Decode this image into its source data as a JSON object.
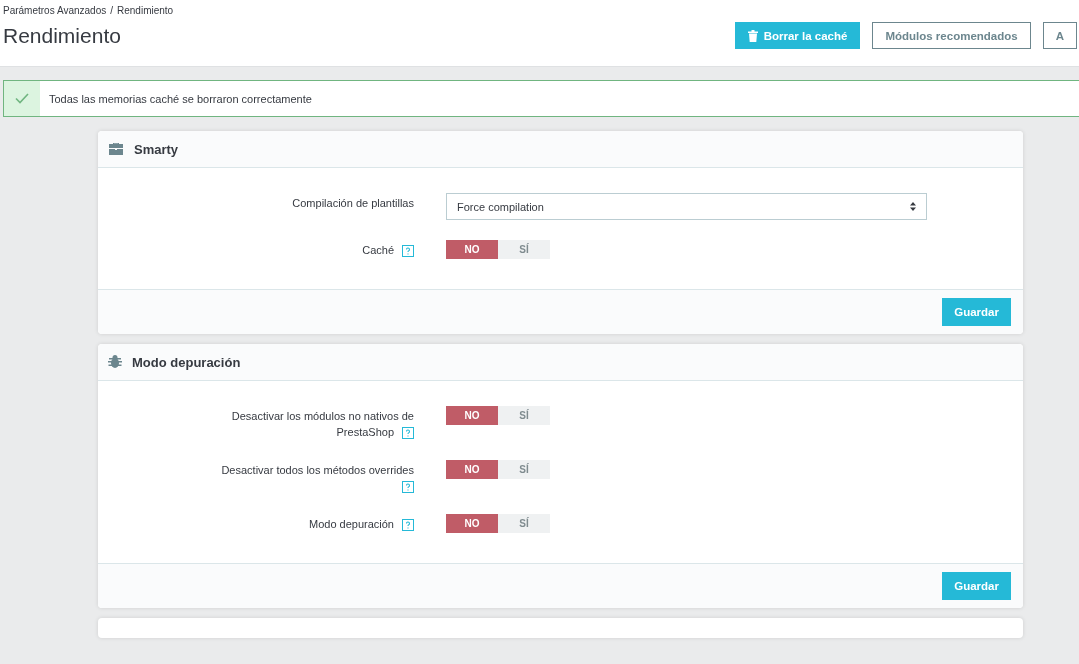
{
  "breadcrumb": [
    "Parámetros Avanzados",
    "Rendimiento"
  ],
  "breadcrumb_separator": "/",
  "title": "Rendimiento",
  "toolbar": [
    {
      "label": "Borrar la caché",
      "kind": "primary"
    },
    {
      "label": "Módulos recomendados",
      "kind": "outline"
    },
    {
      "label": "A",
      "kind": "outline"
    }
  ],
  "alert": {
    "message": "Todas las memorias caché se borraron correctamente"
  },
  "panels": [
    {
      "title": "Smarty",
      "fields": [
        {
          "kind": "select",
          "label": "Compilación de plantillas",
          "value": "Force compilation"
        },
        {
          "kind": "toggle",
          "label": "Caché",
          "help": true,
          "options": [
            {
              "label": "NO",
              "selected": true
            },
            {
              "label": "SÍ",
              "selected": false
            }
          ]
        }
      ],
      "save": "Guardar"
    },
    {
      "title": "Modo depuración",
      "fields": [
        {
          "kind": "toggle",
          "label": "Desactivar los módulos no nativos de PrestaShop",
          "help": true,
          "options": [
            {
              "label": "NO",
              "selected": true
            },
            {
              "label": "SÍ",
              "selected": false
            }
          ]
        },
        {
          "kind": "toggle",
          "label": "Desactivar todos los métodos overrides",
          "help": true,
          "options": [
            {
              "label": "NO",
              "selected": true
            },
            {
              "label": "SÍ",
              "selected": false
            }
          ]
        },
        {
          "kind": "toggle",
          "label": "Modo depuración",
          "help": true,
          "options": [
            {
              "label": "NO",
              "selected": true
            },
            {
              "label": "SÍ",
              "selected": false
            }
          ]
        }
      ],
      "save": "Guardar"
    }
  ]
}
